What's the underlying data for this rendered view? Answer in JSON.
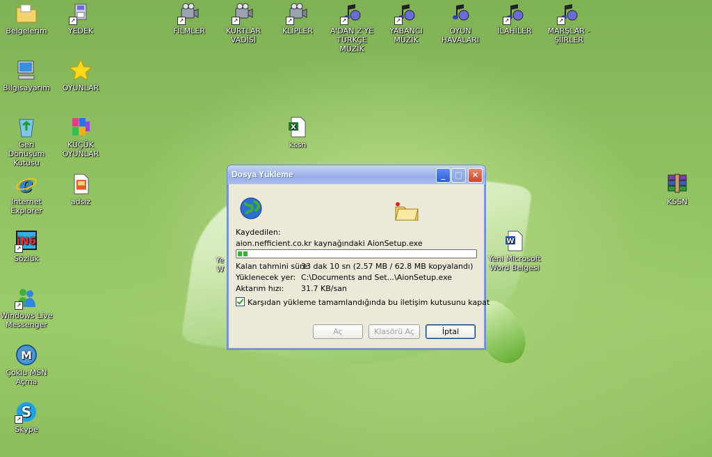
{
  "desktop": {
    "icons": [
      {
        "label": "Belgelerim",
        "icon": "folder-documents-icon"
      },
      {
        "label": "YEDEK",
        "icon": "disk-icon"
      },
      {
        "label": "FİLMLER",
        "icon": "video-camera-icon"
      },
      {
        "label": "KURTLAR VADİSİ",
        "icon": "video-camera-icon"
      },
      {
        "label": "KLİPLER",
        "icon": "video-camera-icon"
      },
      {
        "label": "A'DAN Z'YE TÜRKÇE MÜZİK",
        "icon": "music-note-icon"
      },
      {
        "label": "YABANCI MÜZİK",
        "icon": "music-note-icon"
      },
      {
        "label": "OYUN HAVALARI",
        "icon": "music-note-icon"
      },
      {
        "label": "İLAHİLER",
        "icon": "music-note-icon"
      },
      {
        "label": "MARŞLAR - ŞİİRLER",
        "icon": "music-note-icon"
      },
      {
        "label": "Bilgisayarım",
        "icon": "computer-icon"
      },
      {
        "label": "OYUNLAR",
        "icon": "star-icon"
      },
      {
        "label": "Geri Dönüşüm Kutusu",
        "icon": "recycle-bin-icon"
      },
      {
        "label": "KÜÇÜK OYUNLAR",
        "icon": "winrar-archive-icon"
      },
      {
        "label": "kssn",
        "icon": "excel-file-icon"
      },
      {
        "label": "Internet Explorer",
        "icon": "internet-explorer-icon"
      },
      {
        "label": "adsız",
        "icon": "image-file-icon"
      },
      {
        "label": "KSSN",
        "icon": "winrar-archive-icon"
      },
      {
        "label": "Sözlük",
        "icon": "dictionary-icon"
      },
      {
        "label": "Yeni Microsoft Word Belgesi",
        "icon": "word-file-icon"
      },
      {
        "label": "Windows Live Messenger",
        "icon": "messenger-icon"
      },
      {
        "label": "Çoklu MSN Açma",
        "icon": "msn-icon"
      },
      {
        "label": "Skype",
        "icon": "skype-icon"
      }
    ],
    "partial_labels": [
      "Ye",
      "W"
    ]
  },
  "dialog": {
    "title": "Dosya Yükleme",
    "saved_label": "Kaydedilen:",
    "saved_value": "aion.nefficient.co.kr kaynağındaki AionSetup.exe",
    "progress": 0.04,
    "rows": [
      {
        "key": "Kalan tahmini süre:",
        "value": "33 dak 10 sn (2.57 MB / 62.8 MB kopyalandı)"
      },
      {
        "key": "Yüklenecek yer:",
        "value": "C:\\Documents and Set...\\AionSetup.exe"
      },
      {
        "key": "Aktarım hızı:",
        "value": "31.7 KB/san"
      }
    ],
    "checkbox_label": "Karşıdan yükleme tamamlandığında bu iletişim kutusunu kapat",
    "buttons": {
      "open": "Aç",
      "open_folder": "Klasörü Aç",
      "cancel": "İptal"
    }
  }
}
